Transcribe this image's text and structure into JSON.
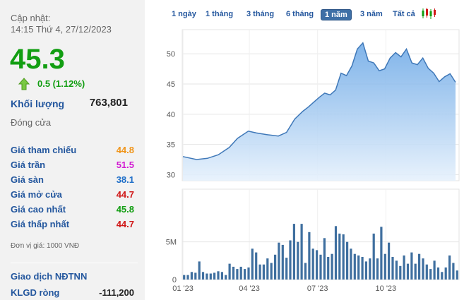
{
  "quote": {
    "update_label": "Cập nhật:",
    "update_time": "14:15 Thứ 4, 27/12/2023",
    "price": "45.3",
    "change": "0.5 (1.12%)",
    "volume_label": "Khối lượng",
    "volume_value": "763,801",
    "close_label": "Đóng cửa",
    "stats": [
      {
        "label": "Giá tham chiếu",
        "value": "44.8",
        "color": "#f0951b"
      },
      {
        "label": "Giá trần",
        "value": "51.5",
        "color": "#d21bd2"
      },
      {
        "label": "Giá sàn",
        "value": "38.1",
        "color": "#1e6ec8"
      },
      {
        "label": "Giá mở cửa",
        "value": "44.7",
        "color": "#d01818"
      },
      {
        "label": "Giá cao nhất",
        "value": "45.8",
        "color": "#129e12"
      },
      {
        "label": "Giá thấp nhất",
        "value": "44.7",
        "color": "#d01818"
      }
    ],
    "unit_note": "Đơn vị giá: 1000 VNĐ",
    "foreign_title": "Giao dịch NĐTNN",
    "foreign_net_label": "KLGD ròng",
    "foreign_net_value": "-111,200"
  },
  "tabs": [
    {
      "label": "1 ngày",
      "active": false
    },
    {
      "label": "1 tháng",
      "active": false
    },
    {
      "label": "3 tháng",
      "active": false
    },
    {
      "label": "6 tháng",
      "active": false
    },
    {
      "label": "1 năm",
      "active": true
    },
    {
      "label": "3 năm",
      "active": false
    },
    {
      "label": "Tất cả",
      "active": false
    }
  ],
  "colors": {
    "up": "#129e12",
    "link": "#24579e",
    "line": "#3f78b8",
    "area_top": "#6aa7e6",
    "area_bottom": "#e6f1fc",
    "bar": "#3f6f9f"
  },
  "icons": {
    "change": "up-arrow-icon",
    "chart_mode": "candlestick-icon"
  },
  "chart_data": [
    {
      "type": "area",
      "title": "",
      "xlabel": "",
      "ylabel": "",
      "ylim": [
        29,
        54
      ],
      "yticks": [
        30,
        35,
        40,
        45,
        50
      ],
      "xticks": [
        "01 '23",
        "04 '23",
        "07 '23",
        "10 '23"
      ],
      "grid": true,
      "x": [
        0,
        0.05,
        0.09,
        0.13,
        0.17,
        0.2,
        0.24,
        0.27,
        0.31,
        0.35,
        0.38,
        0.41,
        0.44,
        0.46,
        0.48,
        0.5,
        0.52,
        0.54,
        0.56,
        0.58,
        0.6,
        0.62,
        0.64,
        0.66,
        0.68,
        0.7,
        0.72,
        0.74,
        0.76,
        0.78,
        0.8,
        0.82,
        0.84,
        0.86,
        0.88,
        0.9,
        0.92,
        0.94,
        0.96,
        0.98,
        1.0
      ],
      "values": [
        33,
        32.5,
        32.7,
        33.3,
        34.5,
        36,
        37.2,
        36.9,
        36.6,
        36.4,
        37,
        39.2,
        40.5,
        41.2,
        42,
        42.8,
        43.5,
        43.2,
        44,
        46.8,
        46.4,
        48,
        50.8,
        51.8,
        48.8,
        48.5,
        47.2,
        47.5,
        49.3,
        50.2,
        49.5,
        50.8,
        48.5,
        48.2,
        49.3,
        47.6,
        46.8,
        45.4,
        46.2,
        46.7,
        45.3
      ],
      "xlim": [
        0,
        1
      ]
    },
    {
      "type": "bar",
      "title": "",
      "xlabel": "",
      "ylabel": "",
      "ylim": [
        0,
        12
      ],
      "yticks": [
        0,
        5
      ],
      "ytick_labels": [
        "0",
        "5M"
      ],
      "grid": true,
      "values": [
        0.6,
        0.6,
        1.0,
        0.9,
        2.4,
        1.0,
        0.8,
        0.8,
        0.9,
        1.1,
        1.0,
        0.6,
        2.1,
        1.7,
        1.4,
        1.7,
        1.4,
        1.6,
        4.1,
        3.6,
        2.0,
        2.0,
        2.8,
        2.2,
        3.3,
        4.9,
        4.6,
        2.9,
        5.2,
        7.4,
        5.0,
        7.4,
        2.2,
        6.3,
        4.1,
        3.9,
        3.3,
        5.5,
        3.0,
        3.4,
        7.1,
        6.1,
        6.0,
        5.0,
        4.1,
        3.4,
        3.2,
        3.0,
        2.4,
        2.8,
        6.1,
        2.8,
        7.0,
        3.4,
        4.9,
        3.0,
        2.5,
        1.8,
        3.2,
        2.1,
        3.6,
        2.1,
        3.4,
        2.8,
        2.0,
        1.4,
        2.5,
        1.6,
        1.0,
        1.6,
        3.2,
        2.2,
        1.2
      ]
    }
  ]
}
